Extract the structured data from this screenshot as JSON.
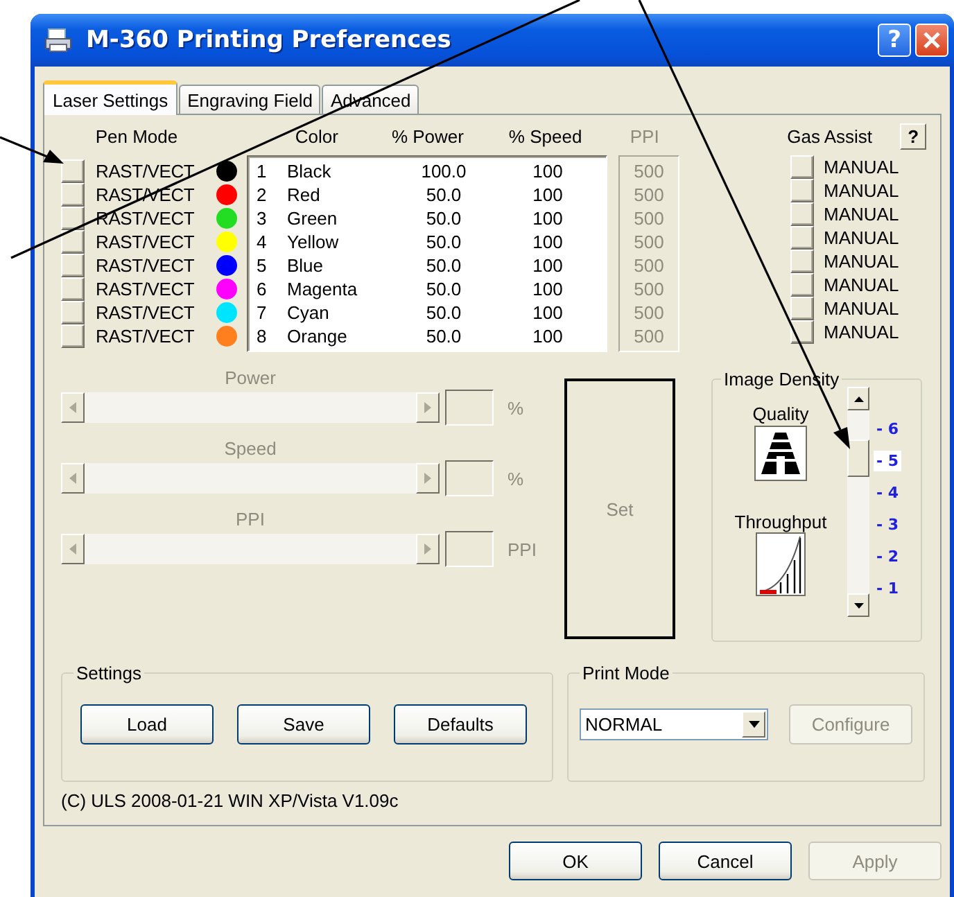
{
  "window": {
    "title": "M-360 Printing Preferences",
    "help_button": "?"
  },
  "tabs": [
    {
      "label": "Laser Settings",
      "selected": true
    },
    {
      "label": "Engraving Field",
      "selected": false
    },
    {
      "label": "Advanced",
      "selected": false
    }
  ],
  "pen_columns": [
    {
      "label": "Pen Mode",
      "disabled": false
    },
    {
      "label": "Color",
      "disabled": false
    },
    {
      "label": "% Power",
      "disabled": false
    },
    {
      "label": "% Speed",
      "disabled": false
    },
    {
      "label": "PPI",
      "disabled": true
    },
    {
      "label": "Gas Assist",
      "disabled": false
    }
  ],
  "gas_help_button": "?",
  "pens": [
    {
      "pen_mode": "RAST/VECT",
      "color": "#000000",
      "number": "1",
      "name": "Black",
      "power": "100.0",
      "speed": "100",
      "ppi": "500",
      "gas_assist": "MANUAL"
    },
    {
      "pen_mode": "RAST/VECT",
      "color": "#ff0000",
      "number": "2",
      "name": "Red",
      "power": "50.0",
      "speed": "100",
      "ppi": "500",
      "gas_assist": "MANUAL"
    },
    {
      "pen_mode": "RAST/VECT",
      "color": "#22dd22",
      "number": "3",
      "name": "Green",
      "power": "50.0",
      "speed": "100",
      "ppi": "500",
      "gas_assist": "MANUAL"
    },
    {
      "pen_mode": "RAST/VECT",
      "color": "#ffff00",
      "number": "4",
      "name": "Yellow",
      "power": "50.0",
      "speed": "100",
      "ppi": "500",
      "gas_assist": "MANUAL"
    },
    {
      "pen_mode": "RAST/VECT",
      "color": "#0000ff",
      "number": "5",
      "name": "Blue",
      "power": "50.0",
      "speed": "100",
      "ppi": "500",
      "gas_assist": "MANUAL"
    },
    {
      "pen_mode": "RAST/VECT",
      "color": "#ff00ff",
      "number": "6",
      "name": "Magenta",
      "power": "50.0",
      "speed": "100",
      "ppi": "500",
      "gas_assist": "MANUAL"
    },
    {
      "pen_mode": "RAST/VECT",
      "color": "#00e5ff",
      "number": "7",
      "name": "Cyan",
      "power": "50.0",
      "speed": "100",
      "ppi": "500",
      "gas_assist": "MANUAL"
    },
    {
      "pen_mode": "RAST/VECT",
      "color": "#ff7f1f",
      "number": "8",
      "name": "Orange",
      "power": "50.0",
      "speed": "100",
      "ppi": "500",
      "gas_assist": "MANUAL"
    }
  ],
  "sliders": [
    {
      "label": "Power",
      "unit": "%",
      "disabled": true
    },
    {
      "label": "Speed",
      "unit": "%",
      "disabled": true
    },
    {
      "label": "PPI",
      "unit": "PPI",
      "disabled": true
    }
  ],
  "set_button": {
    "label": "Set",
    "disabled": true
  },
  "image_density": {
    "title": "Image Density",
    "quality_label": "Quality",
    "throughput_label": "Throughput",
    "ticks": [
      {
        "label": "- 6",
        "selected": false
      },
      {
        "label": "- 5",
        "selected": true
      },
      {
        "label": "- 4",
        "selected": false
      },
      {
        "label": "- 3",
        "selected": false
      },
      {
        "label": "- 2",
        "selected": false
      },
      {
        "label": "- 1",
        "selected": false
      }
    ]
  },
  "settings": {
    "title": "Settings",
    "buttons": [
      {
        "label": "Load",
        "disabled": false
      },
      {
        "label": "Save",
        "disabled": false
      },
      {
        "label": "Defaults",
        "disabled": false
      }
    ]
  },
  "print_mode": {
    "title": "Print Mode",
    "value": "NORMAL",
    "configure": {
      "label": "Configure",
      "disabled": true
    }
  },
  "version": "(C) ULS 2008-01-21 WIN XP/Vista V1.09c",
  "dialog_buttons": [
    {
      "label": "OK",
      "disabled": false
    },
    {
      "label": "Cancel",
      "disabled": false
    },
    {
      "label": "Apply",
      "disabled": true
    }
  ]
}
